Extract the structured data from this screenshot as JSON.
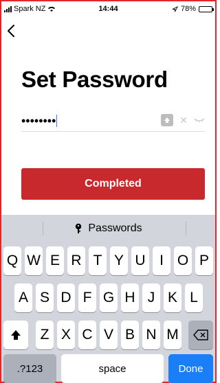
{
  "status_bar": {
    "carrier": "Spark NZ",
    "time": "14:44",
    "battery_text": "78%",
    "battery_level": 0.78,
    "icons": [
      "signal-icon",
      "wifi-icon",
      "location-arrow-icon",
      "battery-icon"
    ]
  },
  "header": {
    "back_icon": "chevron-left-icon",
    "title": "Set Password"
  },
  "password_field": {
    "value": "••••••••",
    "icons": [
      "keychain-icon",
      "clear-icon",
      "eye-closed-icon"
    ]
  },
  "primary_button": {
    "label": "Completed",
    "color": "#c7292d"
  },
  "keyboard": {
    "suggestion_label": "Passwords",
    "row1": [
      "Q",
      "W",
      "E",
      "R",
      "T",
      "Y",
      "U",
      "I",
      "O",
      "P"
    ],
    "row2": [
      "A",
      "S",
      "D",
      "F",
      "G",
      "H",
      "J",
      "K",
      "L"
    ],
    "row3": [
      "Z",
      "X",
      "C",
      "V",
      "B",
      "N",
      "M"
    ],
    "numbers_label": ".?123",
    "space_label": "space",
    "done_label": "Done",
    "done_color": "#1a7ef6"
  }
}
